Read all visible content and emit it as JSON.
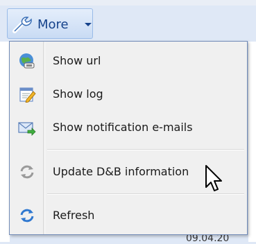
{
  "toolbar": {
    "more_label": "More",
    "more_icon": "wrench-icon"
  },
  "menu": {
    "items": [
      {
        "label": "Show url",
        "icon": "globe-link-icon"
      },
      {
        "label": "Show log",
        "icon": "log-edit-icon"
      },
      {
        "label": "Show notification e-mails",
        "icon": "email-arrow-icon"
      },
      {
        "label": "Update D&B information",
        "icon": "refresh-gray-icon",
        "disabled": true
      },
      {
        "label": "Refresh",
        "icon": "refresh-icon"
      }
    ]
  },
  "background": {
    "partial_date": "09.04.20"
  },
  "colors": {
    "button_text": "#15428b",
    "menu_border": "#718bb7",
    "menu_bg": "#f0f0f0"
  }
}
